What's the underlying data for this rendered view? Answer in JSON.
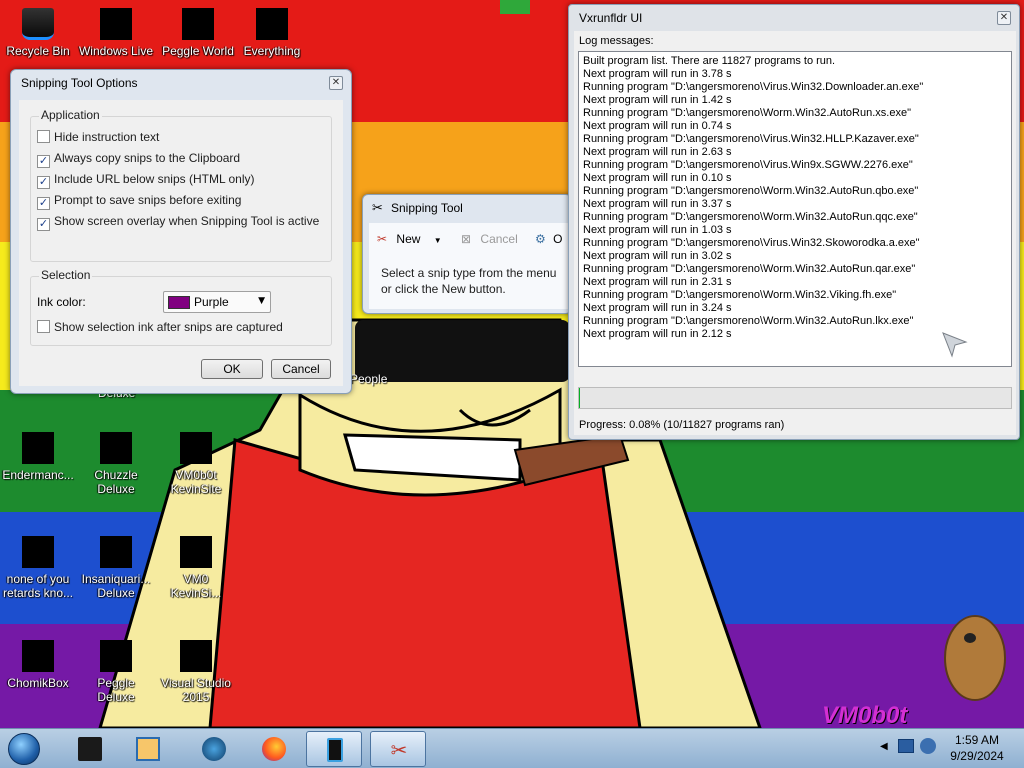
{
  "desktop": {
    "icons": [
      {
        "label": "Recycle Bin"
      },
      {
        "label": "Windows Live"
      },
      {
        "label": "Peggle World"
      },
      {
        "label": "Everything"
      },
      {
        "label": "Deluxe"
      },
      {
        "label": "People"
      },
      {
        "label": "Endermanc..."
      },
      {
        "label": "Chuzzle Deluxe"
      },
      {
        "label": "VM0b0t KevinSite"
      },
      {
        "label": "none of you retards kno..."
      },
      {
        "label": "Insaniquari... Deluxe"
      },
      {
        "label": "VM0 KevinSi..."
      },
      {
        "label": "ChomikBox"
      },
      {
        "label": "Peggle Deluxe"
      },
      {
        "label": "Visual Studio 2015"
      }
    ],
    "watermark": "VM0b0t",
    "colors": {
      "red": "#e41b17",
      "orange": "#f6a21a",
      "yellow": "#f6eb1c",
      "green": "#1d8b2e",
      "blue": "#1d4fcf",
      "purple": "#7519a6"
    }
  },
  "snip_options": {
    "title": "Snipping Tool Options",
    "application_group": "Application",
    "options": [
      {
        "label": "Hide instruction text",
        "checked": false
      },
      {
        "label": "Always copy snips to the Clipboard",
        "checked": true
      },
      {
        "label": "Include URL below snips (HTML only)",
        "checked": true
      },
      {
        "label": "Prompt to save snips before exiting",
        "checked": true
      },
      {
        "label": "Show screen overlay when Snipping Tool is active",
        "checked": true
      }
    ],
    "selection_group": "Selection",
    "ink_label": "Ink color:",
    "ink_value": "Purple",
    "ink_color": "#800080",
    "show_ink_label": "Show selection ink after snips are captured",
    "ok": "OK",
    "cancel": "Cancel"
  },
  "snipping_tool": {
    "title": "Snipping Tool",
    "new": "New",
    "cancel": "Cancel",
    "options_initial": "O",
    "instruction": "Select a snip type from the menu or click the New button."
  },
  "vxrunfldr": {
    "title": "Vxrunfldr UI",
    "log_label": "Log messages:",
    "log": [
      "Built program list. There are 11827 programs to run.",
      "Next program will run in 3.78 s",
      "Running program \"D:\\angersmoreno\\Virus.Win32.Downloader.an.exe\"",
      "Next program will run in 1.42 s",
      "Running program \"D:\\angersmoreno\\Worm.Win32.AutoRun.xs.exe\"",
      "Next program will run in 0.74 s",
      "Running program \"D:\\angersmoreno\\Virus.Win32.HLLP.Kazaver.exe\"",
      "Next program will run in 2.63 s",
      "Running program \"D:\\angersmoreno\\Virus.Win9x.SGWW.2276.exe\"",
      "Next program will run in 0.10 s",
      "Running program \"D:\\angersmoreno\\Worm.Win32.AutoRun.qbo.exe\"",
      "Next program will run in 3.37 s",
      "Running program \"D:\\angersmoreno\\Worm.Win32.AutoRun.qqc.exe\"",
      "Next program will run in 1.03 s",
      "Running program \"D:\\angersmoreno\\Virus.Win32.Skoworodka.a.exe\"",
      "Next program will run in 3.02 s",
      "Running program \"D:\\angersmoreno\\Worm.Win32.AutoRun.qar.exe\"",
      "Next program will run in 2.31 s",
      "Running program \"D:\\angersmoreno\\Worm.Win32.Viking.fh.exe\"",
      "Next program will run in 3.24 s",
      "Running program \"D:\\angersmoreno\\Worm.Win32.AutoRun.lkx.exe\"",
      "Next program will run in 2.12 s"
    ],
    "progress_percent": 0.08,
    "progress_text": "Progress: 0.08% (10/11827 programs ran)"
  },
  "taskbar": {
    "buttons": [
      "start-orb",
      "app-black-box",
      "media-player",
      "globe",
      "firefox",
      "phone-app",
      "snipping-tool"
    ],
    "time": "1:59 AM",
    "date": "9/29/2024"
  }
}
